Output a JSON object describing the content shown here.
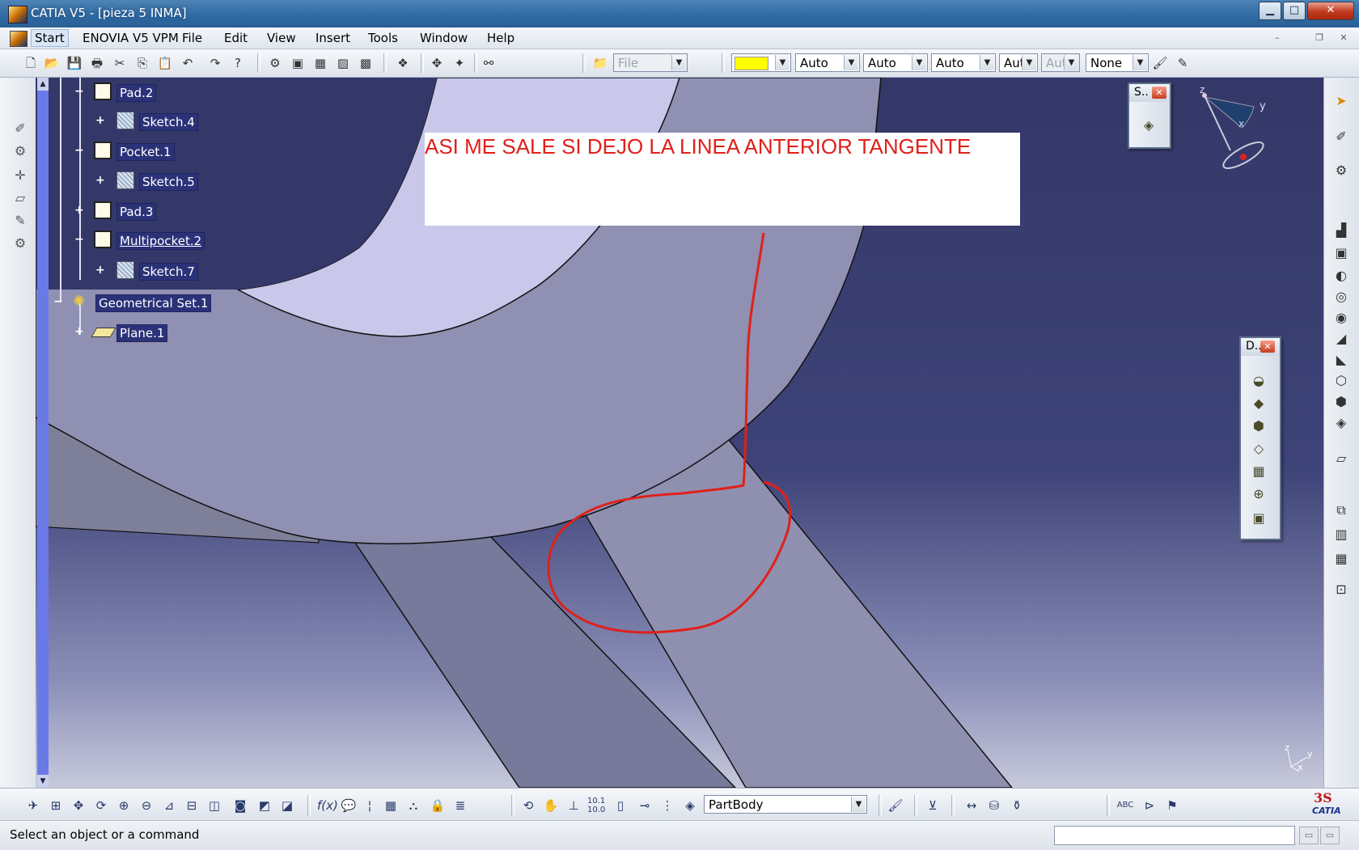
{
  "window": {
    "title": "CATIA V5 - [pieza 5 INMA]",
    "buttons": {
      "minimize": "▁",
      "maximize": "□",
      "close": "✕"
    }
  },
  "menubar": {
    "items": [
      "Start",
      "ENOVIA V5 VPM",
      "File",
      "Edit",
      "View",
      "Insert",
      "Tools",
      "Window",
      "Help"
    ],
    "mdi": {
      "minimize": "–",
      "restore": "❐",
      "close": "✕"
    }
  },
  "toolbar": {
    "file_combo": "File",
    "color": "#ffff00",
    "combos": [
      "Auto",
      "Auto",
      "Auto",
      "Aut",
      "Aut",
      "None"
    ]
  },
  "tree": {
    "nodes": [
      {
        "label": "Pad.2",
        "underline": false
      },
      {
        "label": "Sketch.4",
        "underline": false
      },
      {
        "label": "Pocket.1",
        "underline": false
      },
      {
        "label": "Sketch.5",
        "underline": false
      },
      {
        "label": "Pad.3",
        "underline": false
      },
      {
        "label": "Multipocket.2",
        "underline": true
      },
      {
        "label": "Sketch.7",
        "underline": false
      },
      {
        "label": "Geometrical Set.1",
        "underline": false
      },
      {
        "label": "Plane.1",
        "underline": false
      }
    ]
  },
  "annotation": {
    "text": "ASI ME SALE SI DEJO LA LINEA ANTERIOR TANGENTE",
    "color": "#e0201a"
  },
  "floating_toolbars": {
    "small": {
      "title": "S..",
      "close": "✕"
    },
    "dress_up": {
      "title": "D..",
      "close": "✕"
    }
  },
  "compass": {
    "x": "x",
    "y": "y",
    "z": "z"
  },
  "corner_axis": {
    "x": "x",
    "y": "y",
    "z": "z"
  },
  "bottombar": {
    "body_combo": "PartBody"
  },
  "statusbar": {
    "message": "Select an object or a command"
  },
  "logo": {
    "text": "CATIA"
  }
}
